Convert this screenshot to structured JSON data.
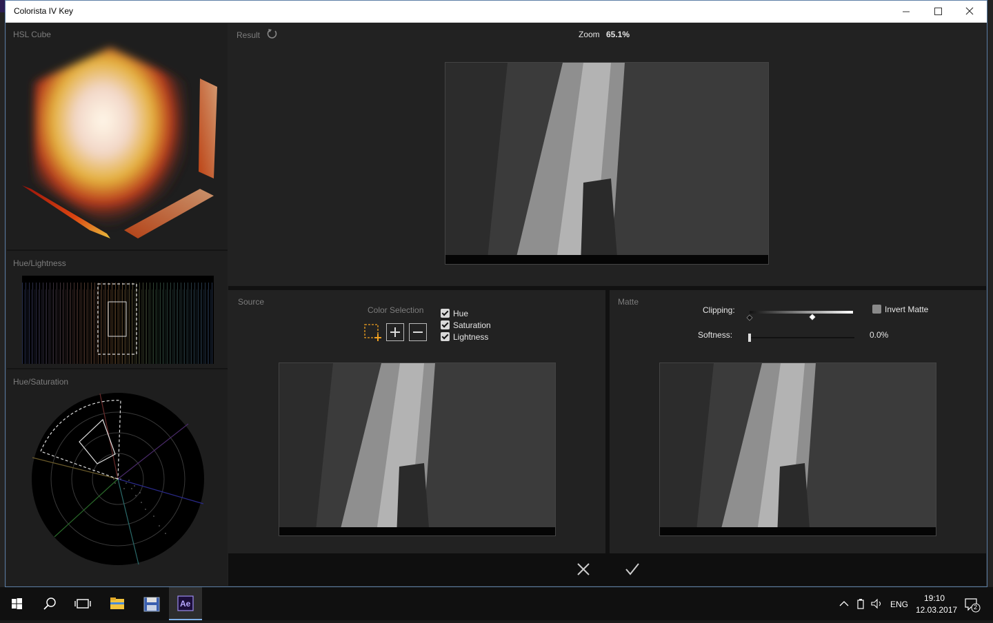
{
  "window": {
    "title": "Colorista IV Key",
    "minimize_icon": "minimize-icon",
    "maximize_icon": "maximize-icon",
    "close_icon": "close-icon"
  },
  "left_panel": {
    "hsl_cube_label": "HSL Cube",
    "hue_lightness_label": "Hue/Lightness",
    "hue_saturation_label": "Hue/Saturation"
  },
  "result": {
    "label": "Result",
    "reset_icon": "reset-icon",
    "zoom_label": "Zoom",
    "zoom_value": "65.1%"
  },
  "source": {
    "label": "Source",
    "color_selection_label": "Color Selection",
    "tools": [
      "select-rect-add-icon",
      "plus-icon",
      "minus-icon"
    ],
    "checkboxes": [
      {
        "label": "Hue",
        "checked": true
      },
      {
        "label": "Saturation",
        "checked": true
      },
      {
        "label": "Lightness",
        "checked": true
      }
    ]
  },
  "matte": {
    "label": "Matte",
    "clipping_label": "Clipping:",
    "softness_label": "Softness:",
    "softness_value": "0.0%",
    "invert_matte_label": "Invert Matte",
    "invert_matte_checked": false
  },
  "bottom_bar": {
    "cancel_icon": "cancel-x-icon",
    "ok_icon": "ok-check-icon"
  },
  "taskbar": {
    "items": [
      "windows-start-icon",
      "search-icon",
      "task-view-icon",
      "file-explorer-icon",
      "save-app-icon",
      "after-effects-icon"
    ],
    "ae_label": "Ae",
    "language": "ENG",
    "time": "19:10",
    "date": "12.03.2017",
    "notification_count": "2"
  },
  "colors": {
    "accent": "#f0a020",
    "window_border": "#5b7ea6",
    "panel_bg": "#222222"
  }
}
